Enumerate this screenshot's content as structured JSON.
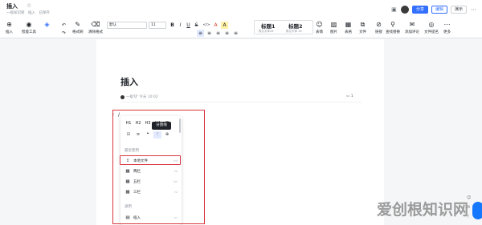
{
  "header": {
    "title": "插入",
    "star": "☆",
    "breadcrumbs": [
      "一级知识库",
      "插入",
      "已保存"
    ]
  },
  "top_actions": {
    "share": "分享",
    "edit": "编辑",
    "present": "演示"
  },
  "toolbar": {
    "insert": "插入",
    "smart": "智能工具",
    "undo": "",
    "redo": "",
    "format_painter": "格式刷",
    "clear_format": "清除格式",
    "font": "默认",
    "size": "11",
    "bold": "B",
    "italic": "I",
    "underline": "U",
    "strike": "S",
    "code": "</>",
    "color": "A",
    "highlight": "A",
    "align_left": "≡",
    "align_center": "≡",
    "indent": "≡",
    "list": "≡",
    "more_list": "≡",
    "h1_label": "标题1",
    "h1_sub": "默认字体28 ·",
    "h2_label": "标题2",
    "h2_sub": "默认字体 16 ·",
    "emoji": "表情",
    "image": "图片",
    "table": "表格",
    "file": "文件",
    "link": "链接",
    "find": "查找替换",
    "comment": "添加评论",
    "summary": "文件提名",
    "more": "更多"
  },
  "doc": {
    "title": "插入",
    "author": "一级🐮",
    "time": "今天 10:02",
    "comments": "1"
  },
  "popup": {
    "row1": [
      "H1",
      "H2",
      "H3",
      "H4",
      "☰"
    ],
    "row2": [
      "☑",
      "≡",
      "❝",
      "⁝",
      "⊕"
    ],
    "tooltip": "分割线",
    "section_recent": "最近使用",
    "items": [
      {
        "icon": "⇪",
        "label": "本地文件",
        "shortcut": "/bd"
      },
      {
        "icon": "▦",
        "label": "两栏",
        "shortcut": "/lb"
      },
      {
        "icon": "▦",
        "label": "五栏",
        "shortcut": "/wl"
      },
      {
        "icon": "▦",
        "label": "三栏",
        "shortcut": "/sl"
      }
    ],
    "section_general": "通用",
    "last_item": {
      "icon": "▤",
      "label": "插入",
      "shortcut": "/cr"
    }
  },
  "watermark": "爱创根知识网"
}
